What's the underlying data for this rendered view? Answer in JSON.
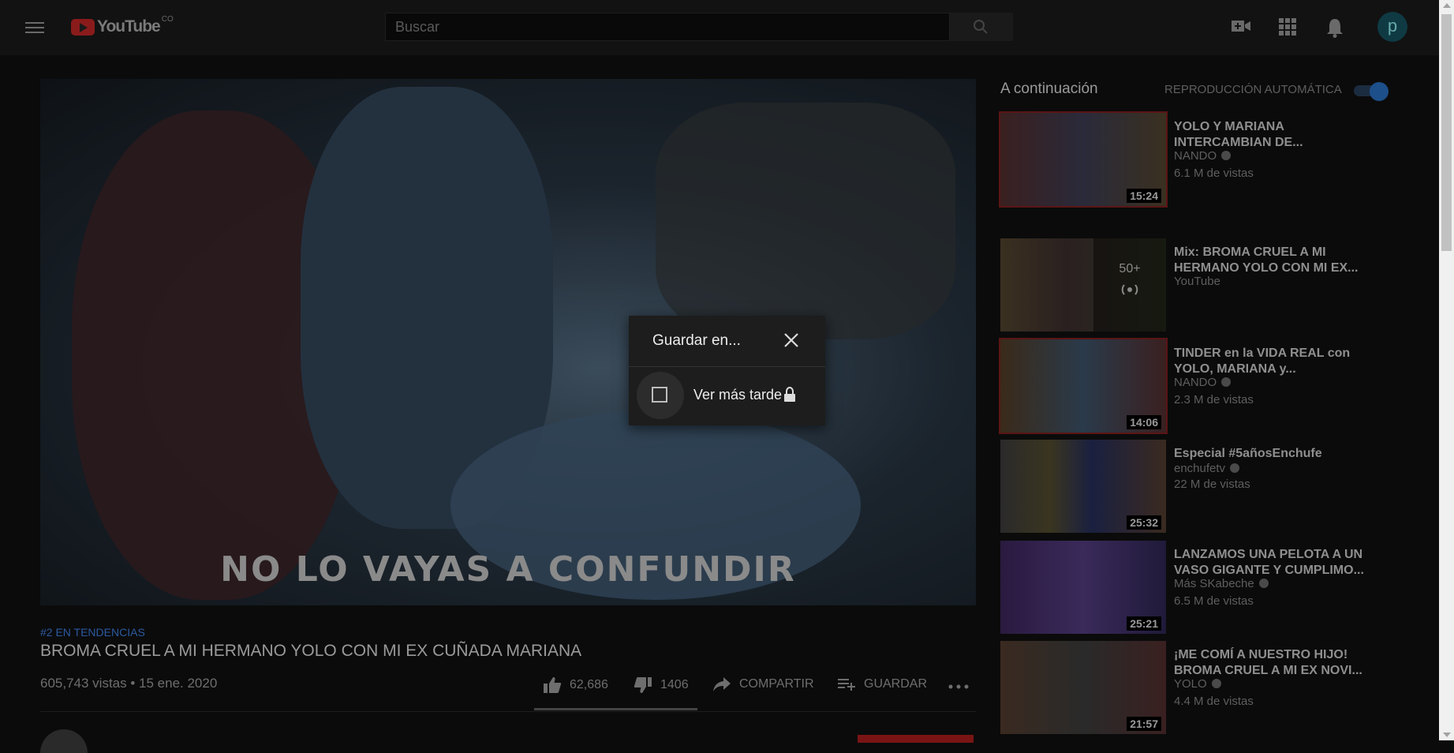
{
  "header": {
    "logo_text": "YouTube",
    "logo_country": "CO",
    "search_placeholder": "Buscar",
    "avatar_letter": "p"
  },
  "video": {
    "caption": "NO LO VAYAS A CONFUNDIR",
    "trending": "#2 EN TENDENCIAS",
    "title": "BROMA CRUEL A MI HERMANO YOLO CON MI EX CUÑADA MARIANA",
    "views_date": "605,743 vistas • 15 ene. 2020",
    "likes": "62,686",
    "dislikes": "1406",
    "share_label": "COMPARTIR",
    "save_label": "GUARDAR"
  },
  "sidebar": {
    "up_next": "A continuación",
    "autoplay": "REPRODUCCIÓN AUTOMÁTICA",
    "autoplay_on": true,
    "items": [
      {
        "title": "YOLO Y MARIANA INTERCAMBIAN DE...",
        "channel": "NANDO",
        "verified": true,
        "views": "6.1 M de vistas",
        "duration": "15:24"
      },
      {
        "title": "Mix: BROMA CRUEL A MI HERMANO YOLO CON MI EX...",
        "channel": "YouTube",
        "verified": false,
        "views": "",
        "duration": "",
        "mix_count": "50+"
      },
      {
        "title": "TINDER en la VIDA REAL con YOLO, MARIANA y...",
        "channel": "NANDO",
        "verified": true,
        "views": "2.3 M de vistas",
        "duration": "14:06"
      },
      {
        "title": "Especial #5añosEnchufe",
        "channel": "enchufetv",
        "verified": true,
        "views": "22 M de vistas",
        "duration": "25:32"
      },
      {
        "title": "LANZAMOS UNA PELOTA A UN VASO GIGANTE Y CUMPLIMO...",
        "channel": "Más SKabeche",
        "verified": true,
        "views": "6.5 M de vistas",
        "duration": "25:21"
      },
      {
        "title": "¡ME COMÍ A NUESTRO HIJO! BROMA CRUEL A MI EX NOVI...",
        "channel": "YOLO",
        "verified": true,
        "views": "4.4 M de vistas",
        "duration": "21:57"
      }
    ]
  },
  "dialog": {
    "title": "Guardar en...",
    "playlist_label": "Ver más tarde",
    "playlist_checked": false
  }
}
